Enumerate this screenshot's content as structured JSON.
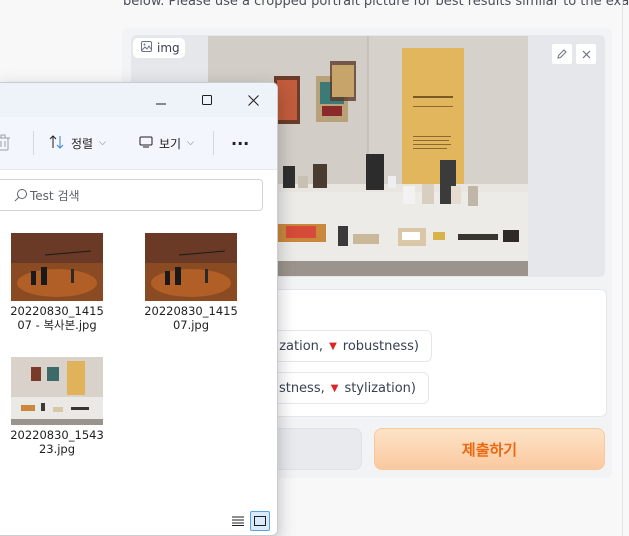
{
  "page": {
    "instruction_text": "below. Please use a cropped portrait picture for best results similar to the exa"
  },
  "image_input": {
    "label": "img",
    "icons": [
      "image-icon",
      "edit-icon",
      "close-icon"
    ]
  },
  "radio_options": [
    {
      "label_before": "stylization,",
      "label_after": "robustness)"
    },
    {
      "label_before": "bustness,",
      "label_after": "stylization)"
    }
  ],
  "submit_button": {
    "label": "제출하기",
    "color": "#ea6a12"
  },
  "explorer": {
    "window_controls": [
      "minimize-icon",
      "maximize-icon",
      "close-icon"
    ],
    "toolbar": {
      "sort_label": "정렬",
      "view_label": "보기",
      "more_label": "···"
    },
    "search": {
      "placeholder": "Test 검색"
    },
    "files": [
      {
        "name": "20220830_141507 - 복사본.jpg"
      },
      {
        "name": "20220830_141507.jpg"
      },
      {
        "name": "20220830_154323.jpg"
      }
    ],
    "view_modes": [
      "details-view-icon",
      "large-icons-view-icon"
    ]
  }
}
